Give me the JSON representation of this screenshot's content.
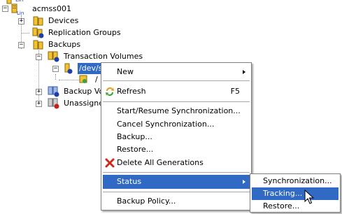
{
  "tree": {
    "top_label": "Lin",
    "host": {
      "label": "acmss001",
      "badge": "Lin"
    },
    "devices": {
      "label": "Devices"
    },
    "replication_groups": {
      "label": "Replication Groups"
    },
    "backups": {
      "label": "Backups"
    },
    "transaction_volumes": {
      "label": "Transaction Volumes"
    },
    "volume": {
      "label": "/dev/s"
    },
    "volume_child": {
      "label": "/"
    },
    "backup_volumes": {
      "label": "Backup Vol"
    },
    "unassigned": {
      "label": "Unassigned"
    }
  },
  "context_menu": {
    "new": "New",
    "refresh": "Refresh",
    "refresh_shortcut": "F5",
    "start_resume_sync": "Start/Resume Synchronization...",
    "cancel_sync": "Cancel Synchronization...",
    "backup": "Backup...",
    "restore": "Restore...",
    "delete_all_generations": "Delete All Generations",
    "status": "Status",
    "backup_policy": "Backup Policy..."
  },
  "status_submenu": {
    "synchronization": "Synchronization...",
    "tracking": "Tracking...",
    "restore": "Restore..."
  },
  "colors": {
    "selection": "#316ac5",
    "folder_yellow": "#f2c230",
    "badge_blue": "#1f3fa8",
    "badge_red": "#c0201a"
  }
}
